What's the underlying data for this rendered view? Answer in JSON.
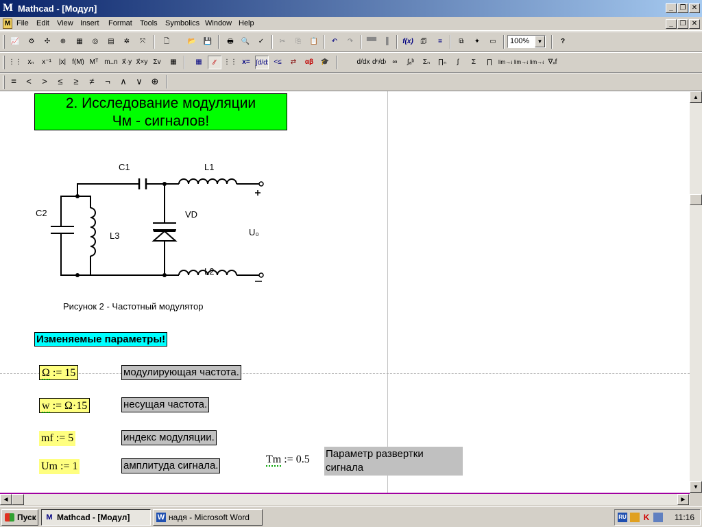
{
  "window": {
    "title": "Mathcad - [Модул]",
    "controls": {
      "minimize": "_",
      "restore": "❐",
      "close": "✕"
    },
    "doc_controls": {
      "minimize": "_",
      "restore": "❐",
      "close": "✕"
    }
  },
  "menu": [
    "File",
    "Edit",
    "View",
    "Insert",
    "Format",
    "Tools",
    "Symbolics",
    "Window",
    "Help"
  ],
  "toolbars": {
    "standard": {
      "zoom": "100%",
      "icons": [
        "graph-toolbar-icon",
        "matrix-toolbar-icon",
        "evaluation-toolbar-icon",
        "calculus-toolbar-icon",
        "boolean-toolbar-icon",
        "programming-toolbar-icon",
        "greek-toolbar-icon",
        "symbolic-toolbar-icon",
        "new-icon",
        "open-icon",
        "save-icon",
        "print-icon",
        "print-preview-icon",
        "spell-check-icon",
        "cut-icon",
        "copy-icon",
        "paste-icon",
        "undo-icon",
        "redo-icon",
        "align-across-icon",
        "align-down-icon",
        "insert-function-icon",
        "insert-unit-icon",
        "calculate-icon",
        "insert-hyperlink-icon",
        "component-wizard-icon",
        "run-mathconnex-icon",
        "resource-center-icon",
        "help-icon"
      ]
    },
    "math": {
      "glyphs": [
        "⋮⋮⋮",
        "xₙ",
        "x⁻¹",
        "|x|",
        "f(M)",
        "Mᵀ",
        "m..n",
        "x⃗·y",
        "x⃗×y",
        "Σv",
        "▦",
        "▦",
        "⁄⁄",
        "⋮⋮",
        "x=",
        "∫d/dx",
        "<≤",
        "⇄",
        "αβ",
        "🎓",
        "d/dx",
        "dⁿ/dxⁿ",
        "∞",
        "∫ₐᵇ",
        "Σₙ",
        "∏ₙ",
        "∫",
        "Σ",
        "∏",
        "lim→a",
        "lim→a+",
        "lim→a-",
        "∇ₓf"
      ]
    },
    "boolean": [
      "=",
      "<",
      ">",
      "≤",
      "≥",
      "≠",
      "¬",
      "∧",
      "∨",
      "⊕"
    ]
  },
  "document": {
    "heading": [
      "2. Исследование модуляции",
      "Чм - сигналов!"
    ],
    "figure": {
      "labels": {
        "c1": "C1",
        "l1": "L1",
        "c2": "C2",
        "vd": "VD",
        "l3": "L3",
        "u0": "U₀",
        "l2": "L2",
        "plus": "+",
        "minus": "−"
      },
      "caption": "Рисунок 2 - Частотный модулятор"
    },
    "params_heading": "Изменяемые параметры!",
    "params": [
      {
        "lhs": "Ω",
        "expr": " := 15",
        "note": "модулирующая частота."
      },
      {
        "lhs": "w",
        "expr": " := Ω·15",
        "note": "несущая частота."
      },
      {
        "lhs": "mf",
        "expr": " := 5",
        "note": "индекс модуляции."
      },
      {
        "lhs": "Um",
        "expr": " := 1",
        "note": "амплитуда сигнала."
      }
    ],
    "tm": {
      "lhs": "Tm",
      "expr": " := 0.5",
      "note": "Параметр развертки сигнала"
    }
  },
  "scroll": {
    "up": "▲",
    "down": "▼",
    "left": "◀",
    "right": "▶"
  },
  "taskbar": {
    "start": "Пуск",
    "tasks": [
      {
        "label": "Mathcad - [Модул]",
        "icon": "M",
        "active": true
      },
      {
        "label": "надя - Microsoft Word",
        "icon": "W",
        "active": false
      }
    ],
    "tray": {
      "lang": "RU",
      "clock": "11:16"
    }
  }
}
